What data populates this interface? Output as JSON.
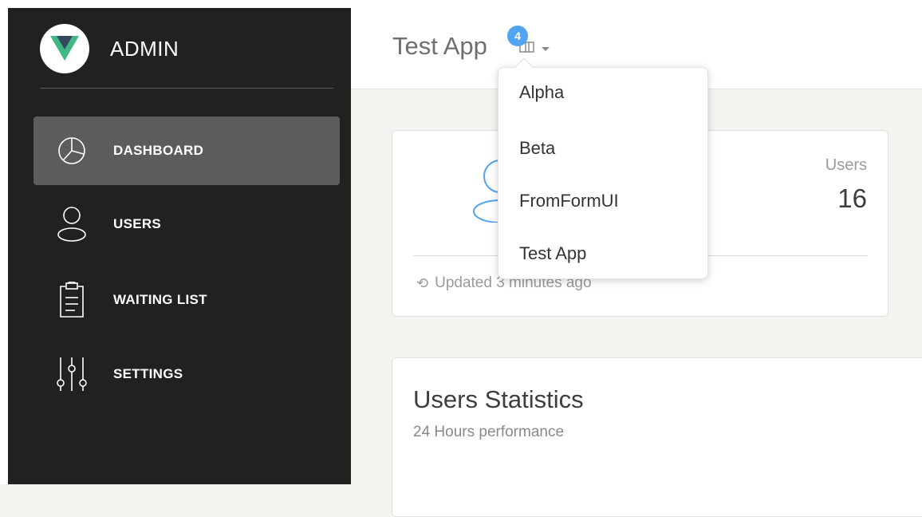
{
  "sidebar": {
    "brand": "ADMIN",
    "items": [
      {
        "label": "DASHBOARD",
        "icon": "pie-chart-icon",
        "active": true
      },
      {
        "label": "USERS",
        "icon": "user-icon",
        "active": false
      },
      {
        "label": "WAITING LIST",
        "icon": "clipboard-icon",
        "active": false
      },
      {
        "label": "SETTINGS",
        "icon": "sliders-icon",
        "active": false
      }
    ]
  },
  "topbar": {
    "app_name": "Test App",
    "badge_count": "4",
    "switch_icon": "app-switch-icon"
  },
  "dropdown": {
    "items": [
      "Alpha",
      "Beta",
      "FromFormUI",
      "Test App"
    ]
  },
  "stats": {
    "label": "Users",
    "value": "16",
    "footer": "Updated 3 minutes ago"
  },
  "chart": {
    "title": "Users Statistics",
    "subtitle": "24 Hours performance"
  },
  "colors": {
    "sidebar_bg": "#212120",
    "sidebar_active": "#5c5c5b",
    "accent_blue": "#51a4f0",
    "logo_green": "#41b883",
    "logo_dark": "#35495e",
    "page_bg": "#f4f3ef"
  }
}
